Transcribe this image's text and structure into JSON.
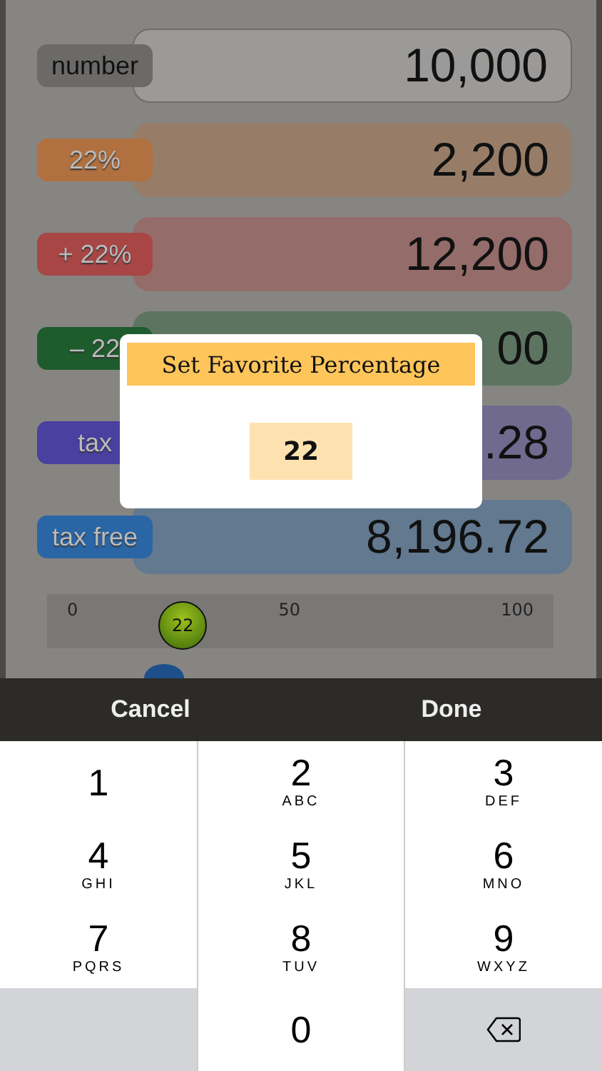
{
  "rows": [
    {
      "label": "number",
      "value": "10,000",
      "color": "#6b6a68",
      "kind": "input"
    },
    {
      "label": "22%",
      "value": "2,200",
      "color": "#b0703f",
      "kind": "result"
    },
    {
      "label": "+ 22%",
      "value": "12,200",
      "color": "#a84646",
      "kind": "result"
    },
    {
      "label": "– 22",
      "value": "00",
      "color": "#1e5c2d",
      "kind": "result"
    },
    {
      "label": "tax",
      "value": ".28",
      "color": "#4a40a0",
      "kind": "result"
    },
    {
      "label": "tax free",
      "value": "8,196.72",
      "color": "#2a66a6",
      "kind": "result"
    }
  ],
  "slider": {
    "ticks": [
      "0",
      "50",
      "100"
    ],
    "level": 0.22,
    "thumb": "22"
  },
  "dialog": {
    "title": "Set Favorite Percentage",
    "value": "22"
  },
  "toolbar": {
    "cancel": "Cancel",
    "done": "Done"
  },
  "keypad": [
    {
      "kind": "digit",
      "digit": "1"
    },
    {
      "kind": "digit",
      "digit": "2",
      "letters": "ABC"
    },
    {
      "kind": "digit",
      "digit": "3",
      "letters": "DEF"
    },
    {
      "kind": "digit",
      "digit": "4",
      "letters": "GHI"
    },
    {
      "kind": "digit",
      "digit": "5",
      "letters": "JKL"
    },
    {
      "kind": "digit",
      "digit": "6",
      "letters": "MNO"
    },
    {
      "kind": "digit",
      "digit": "7",
      "letters": "PQRS"
    },
    {
      "kind": "digit",
      "digit": "8",
      "letters": "TUV"
    },
    {
      "kind": "digit",
      "digit": "9",
      "letters": "WXYZ"
    },
    {
      "kind": "blank"
    },
    {
      "kind": "digit",
      "digit": "0"
    },
    {
      "kind": "delete"
    }
  ]
}
